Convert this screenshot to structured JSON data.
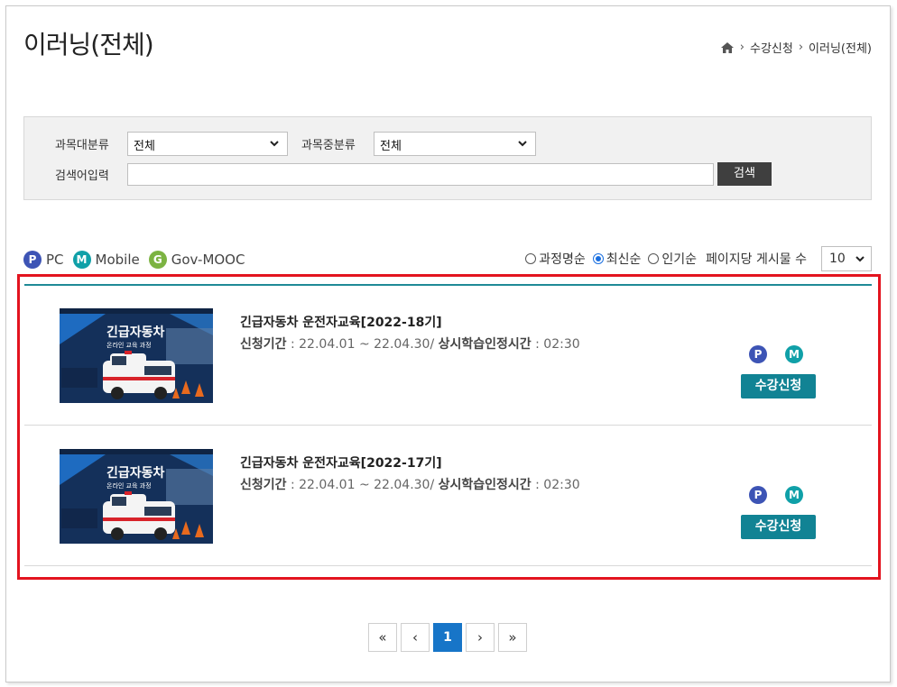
{
  "page": {
    "title": "이러닝(전체)"
  },
  "breadcrumb": {
    "level1": "수강신청",
    "level2": "이러닝(전체)"
  },
  "search": {
    "major_label": "과목대분류",
    "major_value": "전체",
    "minor_label": "과목중분류",
    "minor_value": "전체",
    "keyword_label": "검색어입력",
    "keyword_value": "",
    "button_label": "검색"
  },
  "legend": {
    "pc": {
      "badge": "P",
      "label": "PC"
    },
    "mobile": {
      "badge": "M",
      "label": "Mobile"
    },
    "govmooc": {
      "badge": "G",
      "label": "Gov-MOOC"
    }
  },
  "sort": {
    "options": [
      "과정명순",
      "최신순",
      "인기순"
    ],
    "selected": "최신순",
    "per_page_label": "페이지당 게시물 수",
    "per_page_value": "10"
  },
  "courses": [
    {
      "title": "긴급자동차 운전자교육[2022-18기]",
      "period_label": "신청기간",
      "period_value": " : 22.04.01 ~ 22.04.30/ ",
      "hours_label": "상시학습인정시간",
      "hours_value": " : 02:30",
      "badge_p": "P",
      "badge_m": "M",
      "button": "수강신청",
      "thumb_title": "긴급자동차",
      "thumb_subtitle": "온라인 교육 과정"
    },
    {
      "title": "긴급자동차 운전자교육[2022-17기]",
      "period_label": "신청기간",
      "period_value": " : 22.04.01 ~ 22.04.30/ ",
      "hours_label": "상시학습인정시간",
      "hours_value": " : 02:30",
      "badge_p": "P",
      "badge_m": "M",
      "button": "수강신청",
      "thumb_title": "긴급자동차",
      "thumb_subtitle": "온라인 교육 과정"
    }
  ],
  "pagination": {
    "first": "«",
    "prev": "‹",
    "current": "1",
    "next": "›",
    "last": "»"
  },
  "colors": {
    "accent": "#118394",
    "highlight": "#e3141f",
    "pager_active": "#1775c8",
    "badge_p": "#3d54b5",
    "badge_m": "#10a0a8",
    "badge_g": "#7cb342"
  }
}
